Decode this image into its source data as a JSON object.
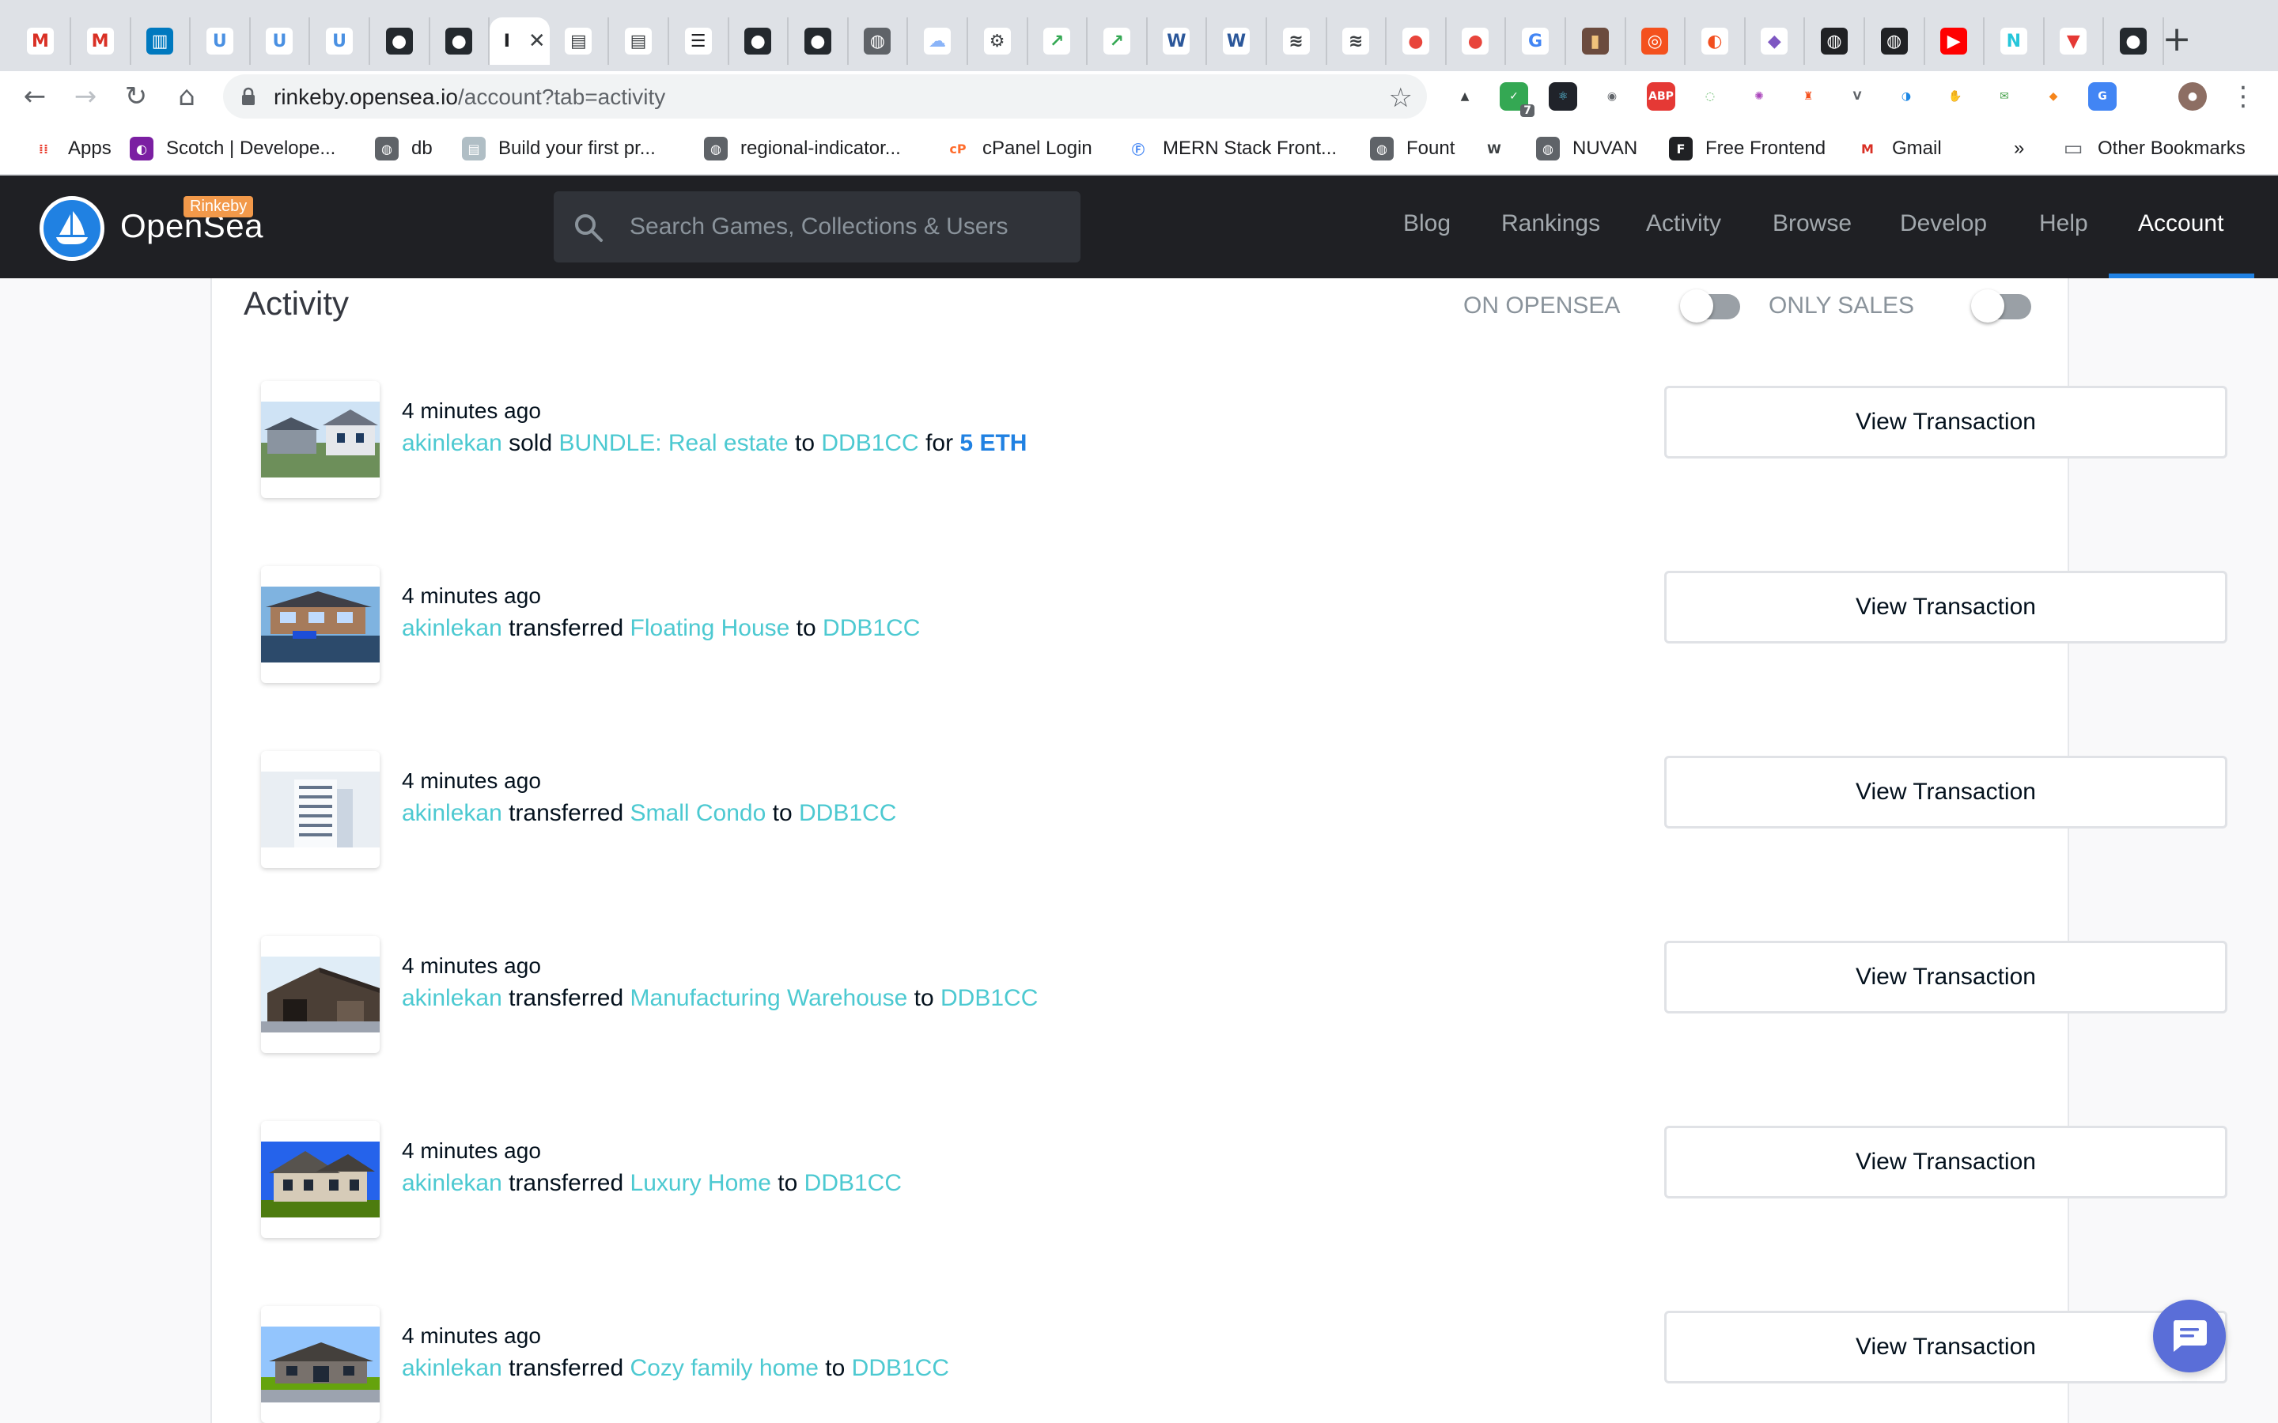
{
  "browser": {
    "tabs": [
      {
        "icon": "gmail-icon",
        "color": "#ffffff",
        "letter": "M",
        "fg": "#d93025"
      },
      {
        "icon": "gmail-icon",
        "color": "#ffffff",
        "letter": "M",
        "fg": "#d93025"
      },
      {
        "icon": "trello-icon",
        "color": "#0079bf",
        "letter": "▥",
        "fg": "#ffffff"
      },
      {
        "icon": "u-icon",
        "color": "#ffffff",
        "letter": "U",
        "fg": "#4a90e2"
      },
      {
        "icon": "u-icon",
        "color": "#ffffff",
        "letter": "U",
        "fg": "#4a90e2"
      },
      {
        "icon": "u-icon",
        "color": "#ffffff",
        "letter": "U",
        "fg": "#4a90e2"
      },
      {
        "icon": "github-icon",
        "color": "#24292e",
        "letter": "●",
        "fg": "#ffffff"
      },
      {
        "icon": "github-icon",
        "color": "#24292e",
        "letter": "●",
        "fg": "#ffffff"
      },
      {
        "icon": "opensea-tab-icon",
        "color": "#ffffff",
        "letter": "I",
        "fg": "#202124",
        "active": true
      },
      {
        "icon": "reader-icon",
        "color": "#ffffff",
        "letter": "▤",
        "fg": "#3c4043"
      },
      {
        "icon": "reader-icon",
        "color": "#ffffff",
        "letter": "▤",
        "fg": "#3c4043"
      },
      {
        "icon": "table-icon",
        "color": "#ffffff",
        "letter": "☰",
        "fg": "#202124"
      },
      {
        "icon": "github-icon",
        "color": "#24292e",
        "letter": "●",
        "fg": "#ffffff"
      },
      {
        "icon": "github-icon",
        "color": "#24292e",
        "letter": "●",
        "fg": "#ffffff"
      },
      {
        "icon": "globe-icon",
        "color": "#5f6368",
        "letter": "◍",
        "fg": "#ffffff"
      },
      {
        "icon": "cloud-icon",
        "color": "#ffffff",
        "letter": "☁",
        "fg": "#8ab4f8"
      },
      {
        "icon": "bike-icon",
        "color": "#ffffff",
        "letter": "⚙",
        "fg": "#3c4043"
      },
      {
        "icon": "leaf-icon",
        "color": "#ffffff",
        "letter": "↗",
        "fg": "#34a853"
      },
      {
        "icon": "leaf-icon",
        "color": "#ffffff",
        "letter": "↗",
        "fg": "#34a853"
      },
      {
        "icon": "word-icon",
        "color": "#ffffff",
        "letter": "W",
        "fg": "#2b579a"
      },
      {
        "icon": "word-icon",
        "color": "#ffffff",
        "letter": "W",
        "fg": "#2b579a"
      },
      {
        "icon": "stack-icon",
        "color": "#ffffff",
        "letter": "≋",
        "fg": "#3c4043"
      },
      {
        "icon": "stack-icon",
        "color": "#ffffff",
        "letter": "≋",
        "fg": "#3c4043"
      },
      {
        "icon": "record-icon",
        "color": "#ffffff",
        "letter": "●",
        "fg": "#e8453c"
      },
      {
        "icon": "record-icon",
        "color": "#ffffff",
        "letter": "●",
        "fg": "#e8453c"
      },
      {
        "icon": "google-icon",
        "color": "#ffffff",
        "letter": "G",
        "fg": "#4285f4"
      },
      {
        "icon": "portrait-icon",
        "color": "#6b4b3e",
        "letter": "▮",
        "fg": "#f0c27b"
      },
      {
        "icon": "target-icon",
        "color": "#f4511e",
        "letter": "◎",
        "fg": "#ffffff"
      },
      {
        "icon": "figma-icon",
        "color": "#ffffff",
        "letter": "◐",
        "fg": "#f24e1e"
      },
      {
        "icon": "cube-icon",
        "color": "#ffffff",
        "letter": "◆",
        "fg": "#7e57c2"
      },
      {
        "icon": "globe-dark-icon",
        "color": "#202124",
        "letter": "◍",
        "fg": "#ffffff"
      },
      {
        "icon": "globe-dark-icon",
        "color": "#202124",
        "letter": "◍",
        "fg": "#ffffff"
      },
      {
        "icon": "youtube-icon",
        "color": "#ff0000",
        "letter": "▶",
        "fg": "#ffffff"
      },
      {
        "icon": "n-icon",
        "color": "#ffffff",
        "letter": "N",
        "fg": "#26c6da"
      },
      {
        "icon": "ribbon-icon",
        "color": "#ffffff",
        "letter": "▼",
        "fg": "#e53935"
      },
      {
        "icon": "github-icon",
        "color": "#24292e",
        "letter": "●",
        "fg": "#ffffff"
      }
    ],
    "url_host": "rinkeby.opensea.io",
    "url_path": "/account?tab=activity",
    "extension_badge": "7",
    "extensions": [
      {
        "icon": "triangle-ext-icon",
        "color": "#ffffff",
        "fg": "#3c4043",
        "glyph": "▲"
      },
      {
        "icon": "shield-ext-icon",
        "color": "#34a853",
        "fg": "#ffffff",
        "glyph": "✓"
      },
      {
        "icon": "react-ext-icon",
        "color": "#20232a",
        "fg": "#61dafb",
        "glyph": "⚛"
      },
      {
        "icon": "camera-ext-icon",
        "color": "#ffffff",
        "fg": "#5f6368",
        "glyph": "◉"
      },
      {
        "icon": "adblock-ext-icon",
        "color": "#e53935",
        "fg": "#ffffff",
        "glyph": "ABP"
      },
      {
        "icon": "spiral-ext-icon",
        "color": "#ffffff",
        "fg": "#66bb6a",
        "glyph": "◌"
      },
      {
        "icon": "color-wheel-ext-icon",
        "color": "#ffffff",
        "fg": "#ab47bc",
        "glyph": "✺"
      },
      {
        "icon": "lighthouse-ext-icon",
        "color": "#ffffff",
        "fg": "#f4511e",
        "glyph": "♜"
      },
      {
        "icon": "vue-ext-icon",
        "color": "#ffffff",
        "fg": "#5f6368",
        "glyph": "V"
      },
      {
        "icon": "palette-ext-icon",
        "color": "#ffffff",
        "fg": "#1e88e5",
        "glyph": "◑"
      },
      {
        "icon": "glove-ext-icon",
        "color": "#ffffff",
        "fg": "#202124",
        "glyph": "✋"
      },
      {
        "icon": "mail-ext-icon",
        "color": "#ffffff",
        "fg": "#43a047",
        "glyph": "✉"
      },
      {
        "icon": "metamask-ext-icon",
        "color": "#ffffff",
        "fg": "#f6851b",
        "glyph": "◆"
      },
      {
        "icon": "translate-ext-icon",
        "color": "#4285f4",
        "fg": "#ffffff",
        "glyph": "G"
      }
    ],
    "bookmarks": [
      {
        "label": "Apps",
        "icon": "apps-grid-icon",
        "color": "#ffffff",
        "fg": "#ea4335",
        "glyph": "⁞⁞"
      },
      {
        "label": "Scotch | Develope...",
        "icon": "scotch-icon",
        "color": "#7b1fa2",
        "fg": "#ffffff",
        "glyph": "◐"
      },
      {
        "label": "db",
        "icon": "globe-icon",
        "color": "#5f6368",
        "fg": "#ffffff",
        "glyph": "◍"
      },
      {
        "label": "Build your first pr...",
        "icon": "page-icon",
        "color": "#b0bec5",
        "fg": "#ffffff",
        "glyph": "▤"
      },
      {
        "label": "regional-indicator...",
        "icon": "globe-icon",
        "color": "#5f6368",
        "fg": "#ffffff",
        "glyph": "◍"
      },
      {
        "label": "cPanel Login",
        "icon": "cpanel-icon",
        "color": "#ffffff",
        "fg": "#ff6c2c",
        "glyph": "cP"
      },
      {
        "label": "MERN Stack Front...",
        "icon": "mern-icon",
        "color": "#ffffff",
        "fg": "#4285f4",
        "glyph": "Ⓕ"
      },
      {
        "label": "Fount",
        "icon": "globe-icon",
        "color": "#5f6368",
        "fg": "#ffffff",
        "glyph": "◍"
      },
      {
        "label": "",
        "icon": "wiki-icon",
        "color": "#ffffff",
        "fg": "#3c4043",
        "glyph": "W"
      },
      {
        "label": "NUVAN",
        "icon": "globe-icon",
        "color": "#5f6368",
        "fg": "#ffffff",
        "glyph": "◍"
      },
      {
        "label": "Free Frontend",
        "icon": "f-logo-icon",
        "color": "#202124",
        "fg": "#ffffff",
        "glyph": "F"
      },
      {
        "label": "Gmail",
        "icon": "gmail-icon",
        "color": "#ffffff",
        "fg": "#d93025",
        "glyph": "M"
      }
    ],
    "overflow_label": "»",
    "other_bookmarks": "Other Bookmarks"
  },
  "header": {
    "logo_text": "OpenSea",
    "network_badge": "Rinkeby",
    "search_placeholder": "Search Games, Collections & Users",
    "nav": [
      "Blog",
      "Rankings",
      "Activity",
      "Browse",
      "Develop",
      "Help",
      "Account"
    ],
    "active_nav": "Account",
    "accent": "#2081e2"
  },
  "activity": {
    "title": "Activity",
    "toggles": [
      {
        "label": "ON OPENSEA",
        "on": false
      },
      {
        "label": "ONLY SALES",
        "on": false
      }
    ],
    "button_label": "View Transaction",
    "link_color": "#4cc9d1",
    "items": [
      {
        "time": "4 minutes ago",
        "actor": "akinlekan",
        "verb": "sold",
        "asset": "BUNDLE: Real estate",
        "prep": "to",
        "target": "DDB1CC",
        "price_prefix": "for",
        "price": "5 ETH",
        "thumb": "bundle"
      },
      {
        "time": "4 minutes ago",
        "actor": "akinlekan",
        "verb": "transferred",
        "asset": "Floating House",
        "prep": "to",
        "target": "DDB1CC",
        "thumb": "floating"
      },
      {
        "time": "4 minutes ago",
        "actor": "akinlekan",
        "verb": "transferred",
        "asset": "Small Condo",
        "prep": "to",
        "target": "DDB1CC",
        "thumb": "condo"
      },
      {
        "time": "4 minutes ago",
        "actor": "akinlekan",
        "verb": "transferred",
        "asset": "Manufacturing Warehouse",
        "prep": "to",
        "target": "DDB1CC",
        "thumb": "warehouse"
      },
      {
        "time": "4 minutes ago",
        "actor": "akinlekan",
        "verb": "transferred",
        "asset": "Luxury Home",
        "prep": "to",
        "target": "DDB1CC",
        "thumb": "luxury"
      },
      {
        "time": "4 minutes ago",
        "actor": "akinlekan",
        "verb": "transferred",
        "asset": "Cozy family home",
        "prep": "to",
        "target": "DDB1CC",
        "thumb": "cozy"
      }
    ]
  },
  "chat": {
    "icon": "chat-bubble-icon",
    "color": "#5a6ed8"
  }
}
